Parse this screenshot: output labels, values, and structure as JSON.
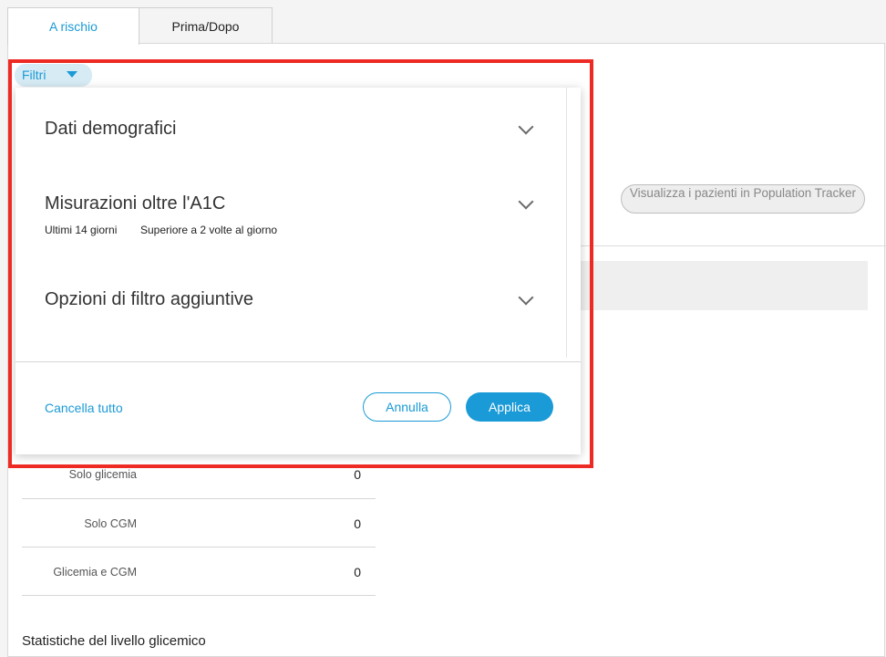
{
  "tabs": {
    "at_risk": "A rischio",
    "before_after": "Prima/Dopo"
  },
  "actions": {
    "view_in_population_tracker": "Visualizza i pazienti in Population Tracker"
  },
  "filter_chip": {
    "label": "Filtri",
    "icon": "caret-down-icon"
  },
  "filter_panel": {
    "sections": [
      {
        "title": "Dati demografici"
      },
      {
        "title": "Misurazioni oltre l'A1C",
        "sub": [
          "Ultimi 14 giorni",
          "Superiore a 2 volte al giorno"
        ]
      },
      {
        "title": "Opzioni di filtro aggiuntive"
      }
    ],
    "clear_all": "Cancella tutto",
    "cancel": "Annulla",
    "apply": "Applica"
  },
  "stats": {
    "rows": [
      {
        "label": "Solo glicemia",
        "value": "0"
      },
      {
        "label": "Solo CGM",
        "value": "0"
      },
      {
        "label": "Glicemia e CGM",
        "value": "0"
      }
    ],
    "heading": "Statistiche del livello glicemico"
  },
  "colors": {
    "accent": "#1a9ad6",
    "highlight": "#ee2a24",
    "chip_bg": "#d7ebf5"
  }
}
